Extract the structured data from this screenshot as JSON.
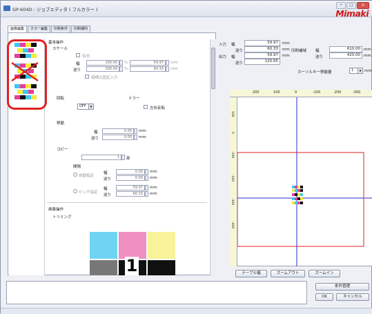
{
  "window": {
    "title": "GP-604D : ジョブエディタ ( フルカラー )",
    "logo": "Mimaki",
    "min": "─",
    "max": "□",
    "close": "×"
  },
  "tabs": [
    "画像編集",
    "カラー編集",
    "印刷条件",
    "印刷補則"
  ],
  "form": {
    "basic_ops": "基本操作",
    "scale": "スケール",
    "enable": "有効",
    "width_label": "幅",
    "feed_label": "送り",
    "scale_w": "100.00",
    "scale_f": "100.00",
    "pct": "%",
    "mm_w": "59.97",
    "mm_f": "60.33",
    "mm": "mm",
    "aspect": "縦横比固定入力",
    "rotate": "回転",
    "rotate_val": "OFF",
    "mirror": "ミラー",
    "mirror_lr": "左右反転",
    "move": "移動",
    "move_w": "0.00",
    "move_f": "0.00",
    "copy": "コピー",
    "copy_count": "1",
    "copy_unit": "部",
    "interval": "間隔",
    "auto": "自動指定",
    "pitch": "ピッチ指定",
    "int_w": "0.00",
    "int_f": "0.00",
    "pitch_w": "59.97",
    "pitch_f": "60.33",
    "image_ops": "画像操作",
    "trimming": "トリミング",
    "swatch_label": "1"
  },
  "info": {
    "input": "入力",
    "output": "出力",
    "width": "幅",
    "feed": "送り",
    "in_w": "59.97",
    "in_f": "60.33",
    "out_w": "59.97",
    "out_f": "120.65",
    "print_area": "印刷補域",
    "pa_w": "610.00",
    "pa_f": "420.00",
    "unit": "mm",
    "cursor_label": "カーソルキー移動量",
    "cursor_val": "1"
  },
  "ruler": {
    "h": [
      "200",
      "100",
      "0",
      "-100",
      "-200",
      "-300"
    ],
    "v": [
      "100",
      "0",
      "-100",
      "-200",
      "-300",
      "-400"
    ]
  },
  "canvas_buttons": [
    "テーブル幅",
    "ズームアウト",
    "ズームイン"
  ],
  "dialog": {
    "manage": "条件管理",
    "ok": "OK",
    "cancel": "キャンセル"
  },
  "colors": {
    "cyan": "#3fc6f0",
    "magenta": "#e83e9a",
    "yellow": "#f4ea3a",
    "black": "#111111",
    "red": "#e02020",
    "blue": "#2b2bd6"
  }
}
